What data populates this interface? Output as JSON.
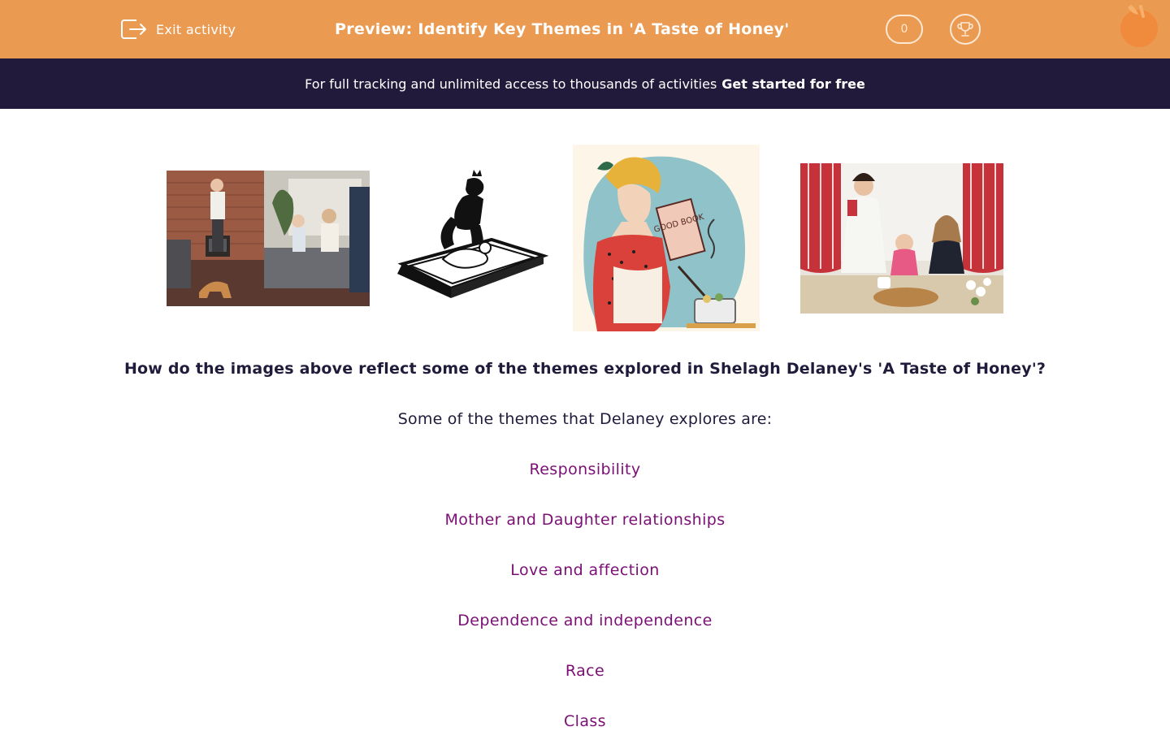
{
  "header": {
    "exit_label": "Exit activity",
    "title": "Preview: Identify Key Themes in 'A Taste of Honey'",
    "score": "0"
  },
  "promo": {
    "text": "For full tracking and unlimited access to thousands of activities",
    "link": "Get started for free"
  },
  "images": {
    "book_text": "GOOD BOOK"
  },
  "content": {
    "question": "How do the images above reflect some of the themes explored in Shelagh Delaney's 'A Taste of Honey'?",
    "intro": "Some of the themes that Delaney explores are:",
    "themes": [
      "Responsibility",
      "Mother and Daughter relationships",
      "Love and affection",
      "Dependence and independence",
      "Race",
      "Class"
    ]
  },
  "colors": {
    "header_bg": "#eb9a52",
    "promo_bg": "#221a3a",
    "theme_text": "#7b0f75",
    "body_text": "#1f1b3a"
  }
}
